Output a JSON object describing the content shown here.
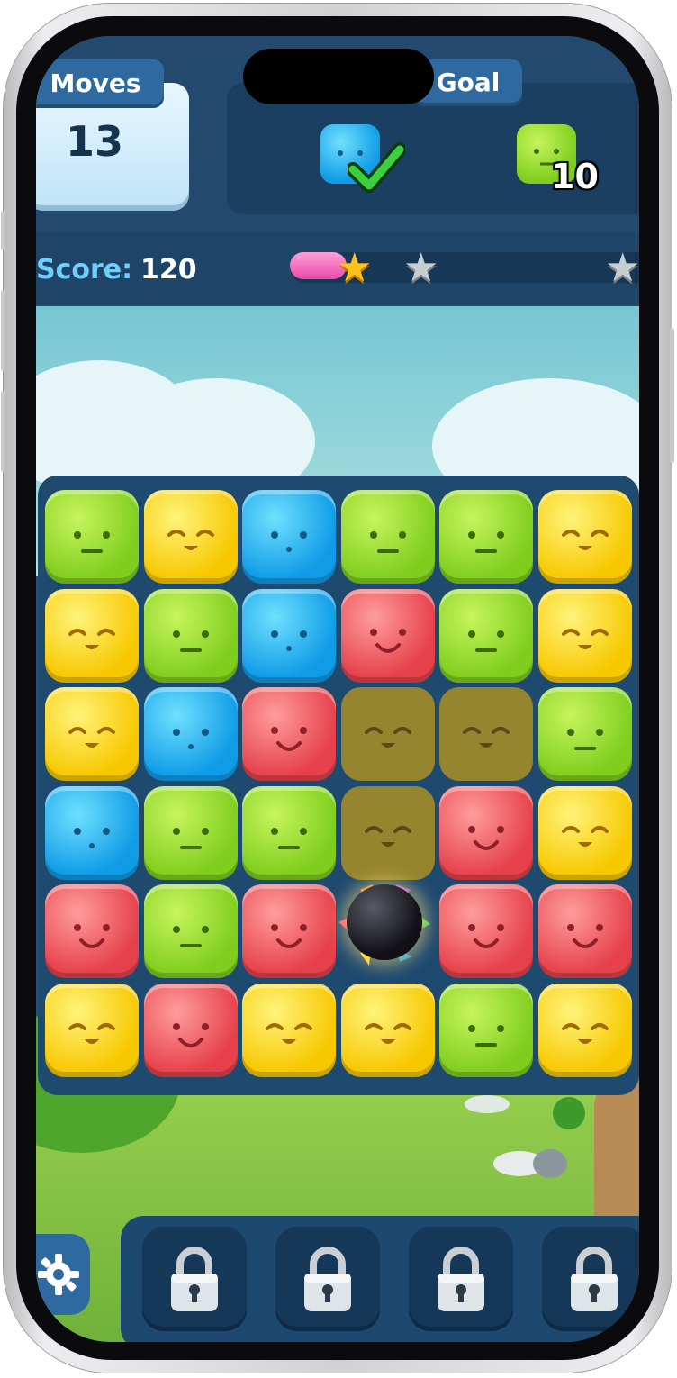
{
  "hud": {
    "moves_label": "Moves",
    "moves_value": "13",
    "goal_label": "Goal",
    "goals": [
      {
        "color": "blue",
        "status": "complete",
        "icon": "check-icon"
      },
      {
        "color": "green",
        "remaining": "10"
      }
    ],
    "score_label": "Score:",
    "score_value": "120",
    "progress_fraction": 0.15,
    "stars_earned": 1,
    "stars_total": 3
  },
  "board": {
    "rows": [
      [
        "green",
        "yellow",
        "blue",
        "green",
        "green",
        "yellow"
      ],
      [
        "yellow",
        "green",
        "blue",
        "red",
        "green",
        "yellow"
      ],
      [
        "yellow",
        "blue",
        "red",
        "dim",
        "dim",
        "green"
      ],
      [
        "blue",
        "green",
        "green",
        "dim",
        "red",
        "yellow"
      ],
      [
        "red",
        "green",
        "red",
        "bomb",
        "red",
        "red"
      ],
      [
        "yellow",
        "red",
        "yellow",
        "yellow",
        "green",
        "yellow"
      ]
    ]
  },
  "colors": {
    "green": "#8bd624",
    "yellow": "#f9d21a",
    "blue": "#1aa8ef",
    "red": "#ec5158",
    "hud_bg": "#234a6e",
    "score_accent": "#6fd0ff",
    "progress_pink": "#ea4aa8"
  },
  "toolbar": {
    "settings_icon": "gear-icon",
    "slots": [
      {
        "icon": "padlock-icon",
        "state": "locked"
      },
      {
        "icon": "padlock-icon",
        "state": "locked"
      },
      {
        "icon": "padlock-icon",
        "state": "locked"
      },
      {
        "icon": "padlock-icon",
        "state": "locked"
      }
    ]
  }
}
